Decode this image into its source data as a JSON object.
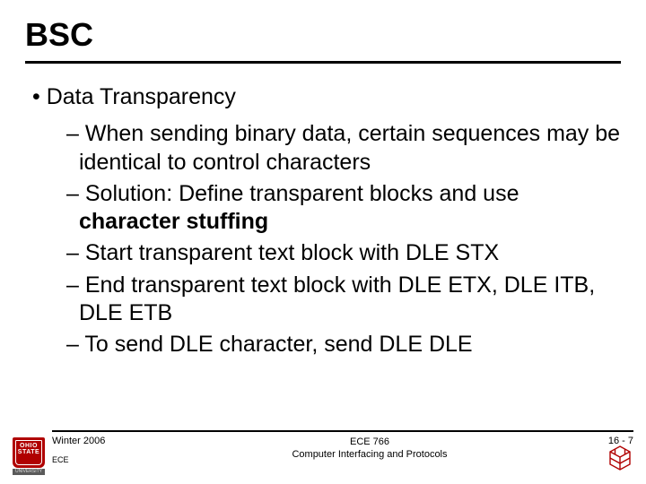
{
  "title": "BSC",
  "section": "Data Transparency",
  "bullets": [
    "When sending binary data, certain sequences may be identical to control characters",
    "Solution: Define transparent blocks and use ",
    "Start transparent text block with DLE STX",
    "End transparent text block with DLE ETX, DLE ITB, DLE ETB",
    "To send DLE character, send DLE DLE"
  ],
  "bold_term": "character stuffing",
  "footer": {
    "term": "Winter 2006",
    "dept": "ECE",
    "course_code": "ECE 766",
    "course_name": "Computer Interfacing and Protocols",
    "page": "16 -   7"
  }
}
